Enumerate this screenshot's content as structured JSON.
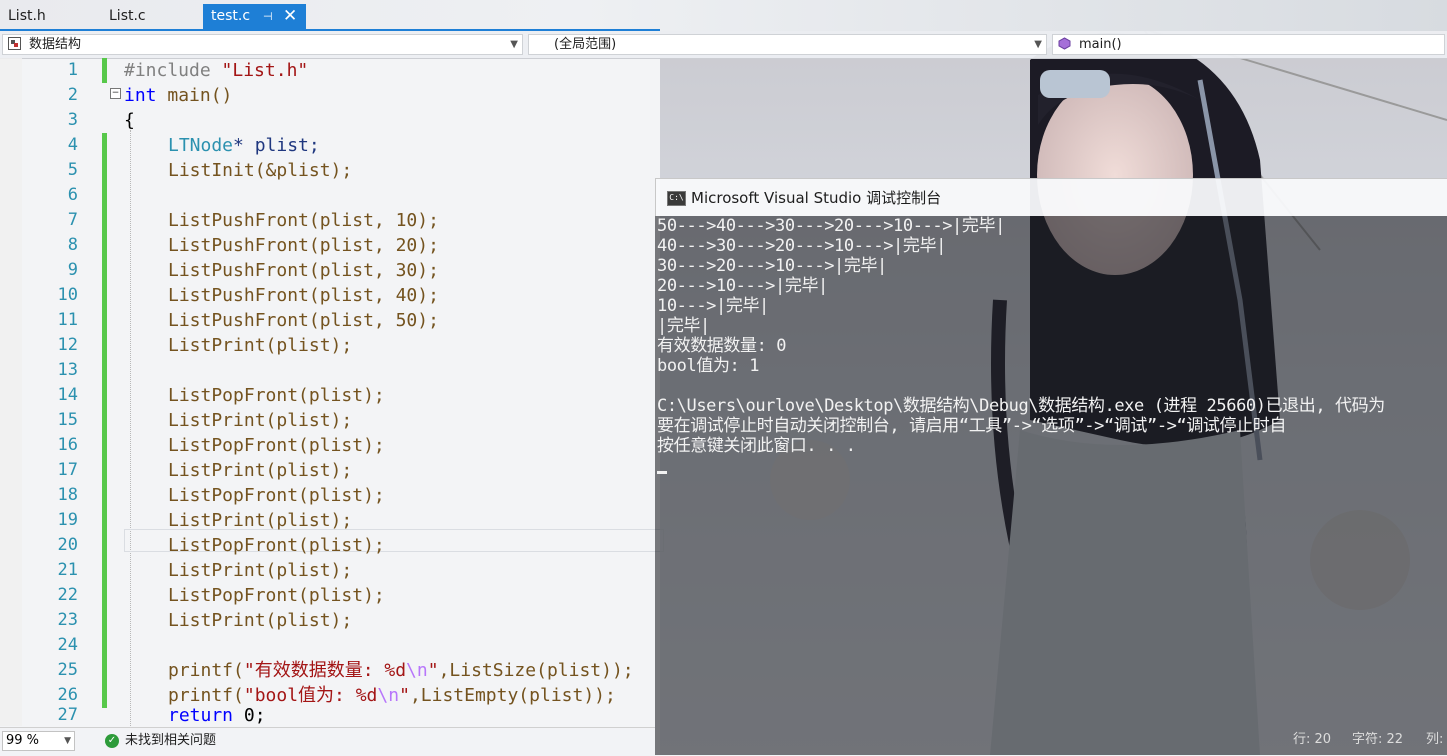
{
  "tabs": [
    {
      "label": "List.h"
    },
    {
      "label": "List.c"
    },
    {
      "label": "test.c",
      "active": true,
      "pin_icon": "pin-icon",
      "close_icon": "close-icon"
    }
  ],
  "nav": {
    "project": "数据结构",
    "scope": "(全局范围)",
    "member": "main()"
  },
  "editor": {
    "line_numbers": [
      "1",
      "2",
      "3",
      "4",
      "5",
      "6",
      "7",
      "8",
      "9",
      "10",
      "11",
      "12",
      "13",
      "14",
      "15",
      "16",
      "17",
      "18",
      "19",
      "20",
      "21",
      "22",
      "23",
      "24",
      "25",
      "26",
      "27"
    ],
    "code": {
      "l1_directive": "#include",
      "l1_header": "\"List.h\"",
      "l2_kw": "int",
      "l2_fn": "main()",
      "l3": "{",
      "l4_type": "LTNode",
      "l4_rest": "* plist;",
      "l5": "ListInit(&plist);",
      "l7": "ListPushFront(plist, 10);",
      "l8": "ListPushFront(plist, 20);",
      "l9": "ListPushFront(plist, 30);",
      "l10": "ListPushFront(plist, 40);",
      "l11": "ListPushFront(plist, 50);",
      "l12": "ListPrint(plist);",
      "l14": "ListPopFront(plist);",
      "l15": "ListPrint(plist);",
      "l16": "ListPopFront(plist);",
      "l17": "ListPrint(plist);",
      "l18": "ListPopFront(plist);",
      "l19": "ListPrint(plist);",
      "l20": "ListPopFront(plist);",
      "l21": "ListPrint(plist);",
      "l22": "ListPopFront(plist);",
      "l23": "ListPrint(plist);",
      "l25_fn": "printf(",
      "l25_str": "\"有效数据数量: %d",
      "l25_esc": "\\n",
      "l25_end": "\"",
      "l25_rest": ",ListSize(plist));",
      "l26_fn": "printf(",
      "l26_str": "\"bool值为: %d",
      "l26_esc": "\\n",
      "l26_end": "\"",
      "l26_rest": ",ListEmpty(plist));",
      "l27_kw": "return",
      "l27_rest": " 0;"
    }
  },
  "console": {
    "title": "Microsoft Visual Studio 调试控制台",
    "icon_text": "C:\\",
    "lines": [
      "50--->40--->30--->20--->10--->|完毕|",
      "40--->30--->20--->10--->|完毕|",
      "30--->20--->10--->|完毕|",
      "20--->10--->|完毕|",
      "10--->|完毕|",
      "|完毕|",
      "有效数据数量: 0",
      "bool值为: 1",
      "",
      "C:\\Users\\ourlove\\Desktop\\数据结构\\Debug\\数据结构.exe (进程 25660)已退出, 代码为",
      "要在调试停止时自动关闭控制台, 请启用“工具”->“选项”->“调试”->“调试停止时自",
      "按任意键关闭此窗口. . ."
    ]
  },
  "status": {
    "zoom": "99 %",
    "issues": "未找到相关问题",
    "row": "行: 20",
    "col": "字符: 22",
    "col_label": "列:"
  },
  "colors": {
    "accent": "#1e7fd6",
    "change_marker": "#57c84a",
    "line_number": "#2b91af"
  }
}
